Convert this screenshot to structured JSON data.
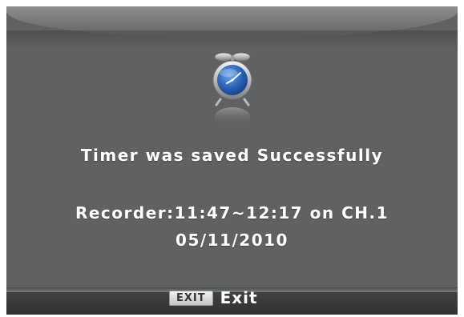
{
  "dialog": {
    "message": "Timer was saved Successfully",
    "recorder_line": "Recorder:11:47~12:17 on CH.1",
    "date": "05/11/2010",
    "icon": "alarm-clock-icon"
  },
  "footer": {
    "key_label": "EXIT",
    "action_label": "Exit"
  },
  "colors": {
    "background": "#5f6162",
    "text": "#ffffff",
    "clock_face": "#2a62b5"
  }
}
